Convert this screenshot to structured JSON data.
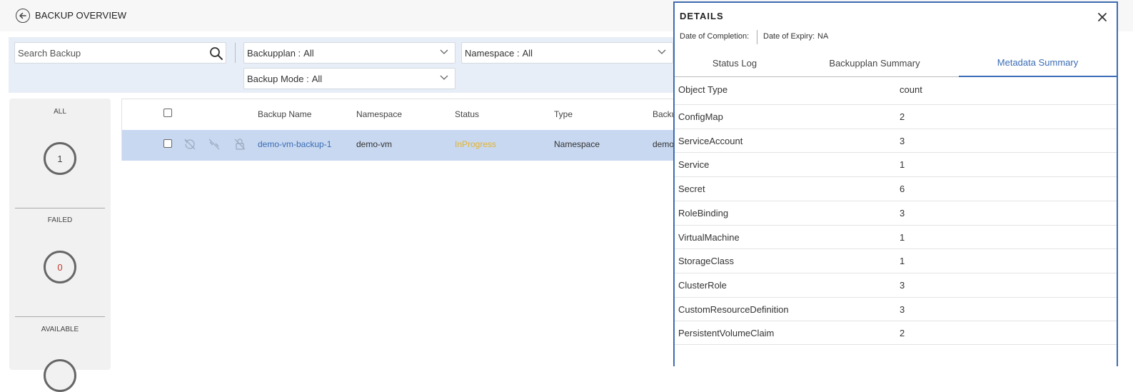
{
  "header": {
    "title": "BACKUP OVERVIEW",
    "back_icon": "arrow-left-circle-icon"
  },
  "filters": {
    "search_placeholder": "Search Backup",
    "search_value": "",
    "backupplan": {
      "label": "Backupplan :",
      "value": "All"
    },
    "namespace": {
      "label": "Namespace :",
      "value": "All"
    },
    "backup_mode": {
      "label": "Backup Mode :",
      "value": "All"
    }
  },
  "stats": [
    {
      "label": "ALL",
      "count": "1",
      "color": "#444444"
    },
    {
      "label": "FAILED",
      "count": "0",
      "color": "#c0392b"
    },
    {
      "label": "AVAILABLE",
      "count": "",
      "color": "#444444"
    }
  ],
  "table": {
    "columns": [
      "Backup Name",
      "Namespace",
      "Status",
      "Type",
      "Backu"
    ],
    "rows": [
      {
        "name": "demo-vm-backup-1",
        "namespace": "demo-vm",
        "status": "InProgress",
        "type": "Namespace",
        "backupplan": "demo"
      }
    ],
    "status_color": "#e2b32e",
    "link_color": "#3b6db5",
    "selected_row_color": "#c8d8f0"
  },
  "details": {
    "title": "DETAILS",
    "date_of_completion_label": "Date of Completion:",
    "date_of_completion_value": "",
    "date_of_expiry_label": "Date of Expiry:",
    "date_of_expiry_value": "NA",
    "tabs": [
      "Status Log",
      "Backupplan Summary",
      "Metadata Summary"
    ],
    "active_tab": "Metadata Summary",
    "metadata": {
      "col_object_type": "Object Type",
      "col_count": "count",
      "rows": [
        {
          "type": "ConfigMap",
          "count": "2"
        },
        {
          "type": "ServiceAccount",
          "count": "3"
        },
        {
          "type": "Service",
          "count": "1"
        },
        {
          "type": "Secret",
          "count": "6"
        },
        {
          "type": "RoleBinding",
          "count": "3"
        },
        {
          "type": "VirtualMachine",
          "count": "1"
        },
        {
          "type": "StorageClass",
          "count": "1"
        },
        {
          "type": "ClusterRole",
          "count": "3"
        },
        {
          "type": "CustomResourceDefinition",
          "count": "3"
        },
        {
          "type": "PersistentVolumeClaim",
          "count": "2"
        }
      ]
    },
    "accent_color": "#3b6db5"
  }
}
